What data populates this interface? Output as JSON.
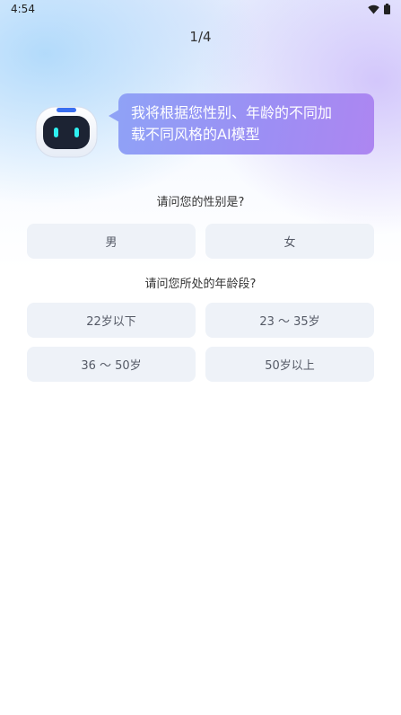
{
  "status_bar": {
    "time": "4:54",
    "wifi_icon": "wifi-icon",
    "battery_icon": "battery-icon"
  },
  "progress": {
    "text": "1/4",
    "current": 1,
    "total": 4
  },
  "assistant": {
    "avatar_icon": "robot-icon",
    "message_line1": "我将根据您性别、年龄的不同加",
    "message_line2": "载不同风格的AI模型"
  },
  "gender": {
    "question": "请问您的性别是?",
    "options": [
      "男",
      "女"
    ]
  },
  "age": {
    "question": "请问您所处的年龄段?",
    "options": [
      "22岁以下",
      "23 ～ 35岁",
      "36 ～ 50岁",
      "50岁以上"
    ]
  },
  "colors": {
    "bubble_start": "#8fa2f6",
    "bubble_end": "#ad86f1",
    "option_bg": "#eef2f8",
    "robot_eye": "#2ff0f0",
    "robot_accent": "#3a6ff0"
  }
}
